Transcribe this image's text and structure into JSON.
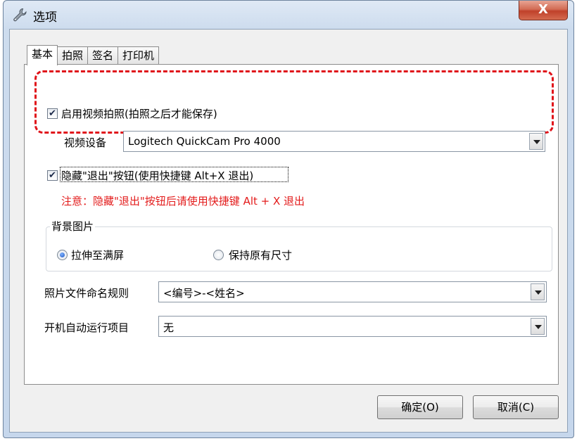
{
  "window": {
    "title": "选项",
    "close_label": "X"
  },
  "tabs": [
    {
      "label": "基本",
      "active": true
    },
    {
      "label": "拍照",
      "active": false
    },
    {
      "label": "签名",
      "active": false
    },
    {
      "label": "打印机",
      "active": false
    }
  ],
  "basic": {
    "enable_video_capture": {
      "label": "启用视频拍照(拍照之后才能保存)",
      "checked": true
    },
    "video_device": {
      "label": "视频设备",
      "value": "Logitech QuickCam Pro 4000"
    },
    "hide_exit_button": {
      "label": "隐藏\"退出\"按钮(使用快捷键 Alt+X 退出)",
      "checked": true
    },
    "warning": "注意：隐藏\"退出\"按钮后请使用快捷键 Alt + X 退出",
    "background_group": {
      "title": "背景图片",
      "options": [
        {
          "label": "拉伸至满屏",
          "checked": true
        },
        {
          "label": "保持原有尺寸",
          "checked": false
        }
      ]
    },
    "photo_naming": {
      "label": "照片文件命名规则",
      "value": "<编号>-<姓名>"
    },
    "startup_item": {
      "label": "开机自动运行项目",
      "value": "无"
    }
  },
  "buttons": {
    "ok": "确定(O)",
    "cancel": "取消(C)"
  },
  "colors": {
    "warning": "#e31b1b",
    "dashed_highlight": "#e0131a"
  }
}
